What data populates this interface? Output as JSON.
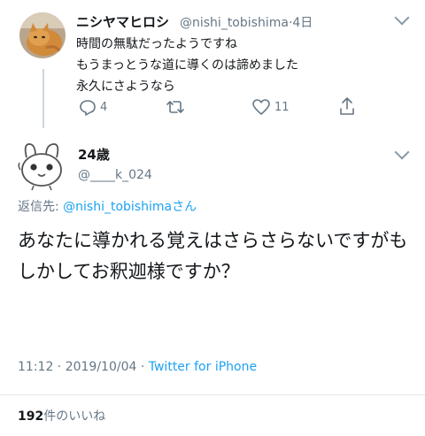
{
  "parent_tweet": {
    "display_name": "ニシヤマヒロシ",
    "handle": "@nishi_tobishima",
    "separator": "·",
    "time_ago": "4日",
    "text": "時間の無駄だったようですね\nもうまっとうな道に導くのは諦めました\n永久にさようなら",
    "reply_count": "4",
    "like_count": "11",
    "icons": [
      "reply-icon",
      "retweet-icon",
      "heart-icon",
      "share-icon",
      "chevron-down-icon"
    ]
  },
  "main_tweet": {
    "display_name": "24歳",
    "handle": "@____k_024",
    "reply_prefix": "返信先: ",
    "reply_to": "@nishi_tobishima",
    "reply_suffix": "さん",
    "text": "あなたに導かれる覚えはさらさらないですがもしかしてお釈迦様ですか？",
    "timestamp": "11:12 · 2019/10/04 · ",
    "source": "Twitter for iPhone",
    "likes_count": "192",
    "likes_label": "件のいいね"
  },
  "colors": {
    "accent": "#1da1f2",
    "muted": "#657786",
    "icon": "#8899a6"
  }
}
